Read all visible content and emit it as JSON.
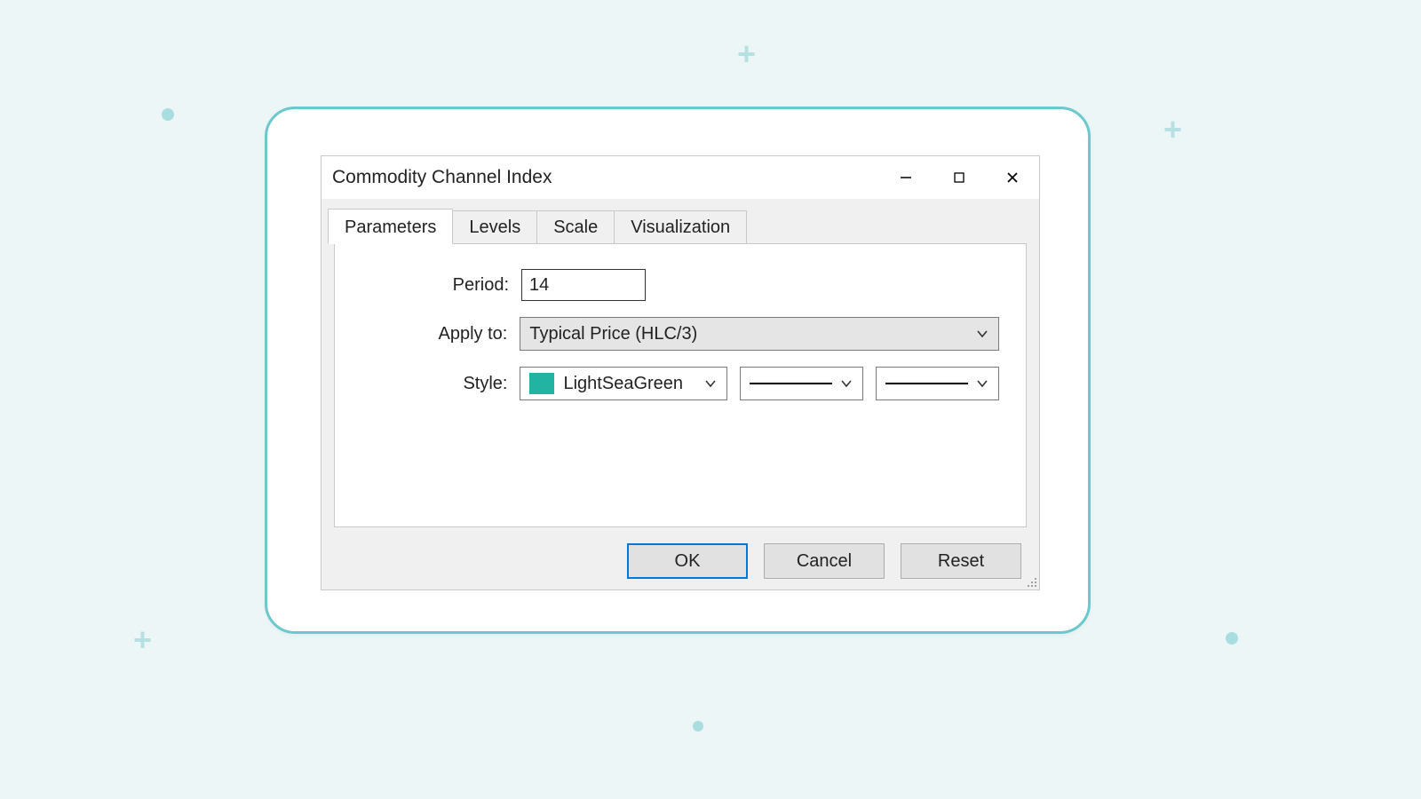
{
  "window": {
    "title": "Commodity Channel Index"
  },
  "tabs": [
    {
      "label": "Parameters",
      "active": true
    },
    {
      "label": "Levels",
      "active": false
    },
    {
      "label": "Scale",
      "active": false
    },
    {
      "label": "Visualization",
      "active": false
    }
  ],
  "form": {
    "period_label": "Period:",
    "period_value": "14",
    "apply_to_label": "Apply to:",
    "apply_to_value": "Typical Price (HLC/3)",
    "style_label": "Style:",
    "style_color_name": "LightSeaGreen",
    "style_color_hex": "#23b3a3"
  },
  "buttons": {
    "ok": "OK",
    "cancel": "Cancel",
    "reset": "Reset"
  },
  "icons": {
    "minimize": "minimize-icon",
    "maximize": "maximize-icon",
    "close": "close-icon",
    "chevron_down": "chevron-down-icon"
  }
}
